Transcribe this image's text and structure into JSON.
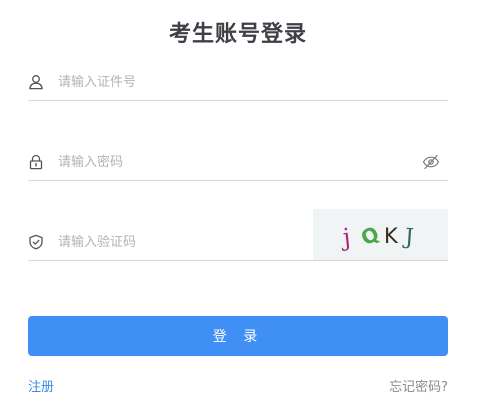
{
  "title": "考生账号登录",
  "fields": {
    "id_number": {
      "placeholder": "请输入证件号",
      "value": ""
    },
    "password": {
      "placeholder": "请输入密码",
      "value": ""
    },
    "captcha": {
      "placeholder": "请输入验证码",
      "value": ""
    }
  },
  "captcha_image": {
    "chars": [
      {
        "char": "j",
        "color": "#b0247a"
      },
      {
        "char": "Q",
        "color": "#4ca64c"
      },
      {
        "char": "K",
        "color": "#3a2a1a"
      },
      {
        "char": "J",
        "color": "#2f6b66"
      }
    ]
  },
  "buttons": {
    "login": "登 录"
  },
  "links": {
    "register": "注册",
    "forgot": "忘记密码?"
  },
  "colors": {
    "primary": "#3f8ff5",
    "link": "#3b8ee8",
    "title": "#3f3f46",
    "divider": "#d9d9d9"
  },
  "icons": {
    "id_field": "user-icon",
    "password_field": "lock-icon",
    "captcha_field": "shield-check-icon",
    "password_toggle": "eye-off-icon"
  }
}
